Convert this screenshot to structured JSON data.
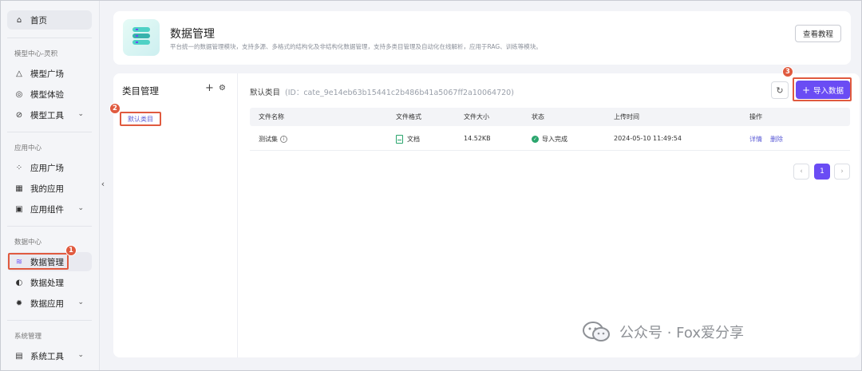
{
  "sidebar": {
    "home_label": "首页",
    "groups": [
      {
        "title": "模型中心-灵积"
      },
      {
        "title": "应用中心"
      },
      {
        "title": "数据中心"
      },
      {
        "title": "系统管理"
      }
    ],
    "items": [
      {
        "label": "模型广场"
      },
      {
        "label": "模型体验"
      },
      {
        "label": "模型工具"
      },
      {
        "label": "应用广场"
      },
      {
        "label": "我的应用"
      },
      {
        "label": "应用组件"
      },
      {
        "label": "数据管理"
      },
      {
        "label": "数据处理"
      },
      {
        "label": "数据应用"
      },
      {
        "label": "系统工具"
      }
    ]
  },
  "header": {
    "title": "数据管理",
    "description": "平台统一的数据管理模块，支持多源、多格式的结构化及非结构化数据管理，支持多类目管理及自动化在线解析，应用于RAG、训练等模块。",
    "tutorial_button": "查看教程"
  },
  "category_panel": {
    "title": "类目管理",
    "add_symbol": "+",
    "items": [
      {
        "label": "默认类目"
      }
    ]
  },
  "content": {
    "category_name": "默认类目",
    "category_id": "(ID：cate_9e14eb63b15441c2b486b41a5067ff2a10064720)",
    "import_button": "导入数据",
    "columns": [
      "文件名称",
      "文件格式",
      "文件大小",
      "状态",
      "上传时间",
      "操作"
    ],
    "rows": [
      {
        "name": "测试集",
        "format": "文档",
        "size": "14.52KB",
        "status": "导入完成",
        "uploaded": "2024-05-10 11:49:54",
        "actions": [
          "详情",
          "删除"
        ]
      }
    ],
    "pagination": {
      "current": "1"
    }
  },
  "annotations": {
    "n1": "1",
    "n2": "2",
    "n3": "3"
  },
  "watermark": "公众号 · Fox爱分享",
  "colors": {
    "accent": "#6a4cf4",
    "highlight": "#e05a3f",
    "success": "#2aa56d"
  }
}
